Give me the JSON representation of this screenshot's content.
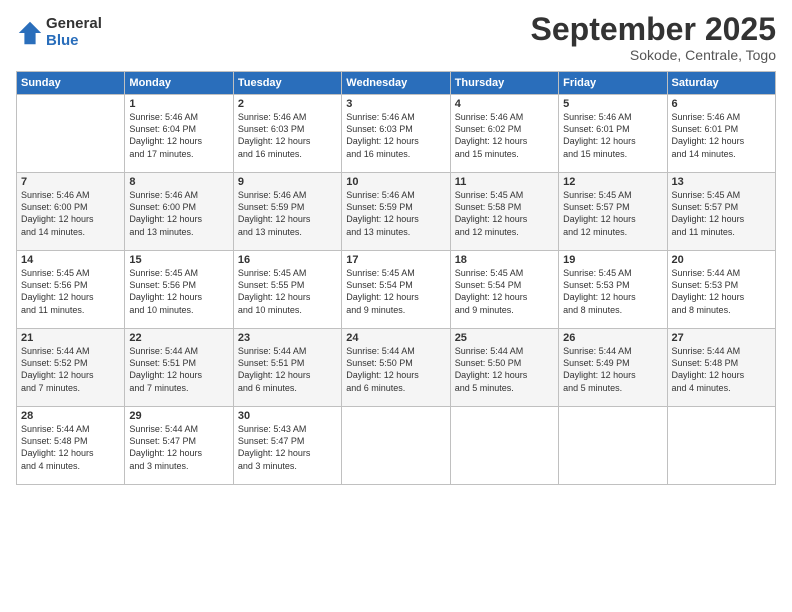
{
  "logo": {
    "general": "General",
    "blue": "Blue"
  },
  "header": {
    "month": "September 2025",
    "location": "Sokode, Centrale, Togo"
  },
  "days_of_week": [
    "Sunday",
    "Monday",
    "Tuesday",
    "Wednesday",
    "Thursday",
    "Friday",
    "Saturday"
  ],
  "weeks": [
    [
      {
        "day": "",
        "data": ""
      },
      {
        "day": "1",
        "data": "Sunrise: 5:46 AM\nSunset: 6:04 PM\nDaylight: 12 hours\nand 17 minutes."
      },
      {
        "day": "2",
        "data": "Sunrise: 5:46 AM\nSunset: 6:03 PM\nDaylight: 12 hours\nand 16 minutes."
      },
      {
        "day": "3",
        "data": "Sunrise: 5:46 AM\nSunset: 6:03 PM\nDaylight: 12 hours\nand 16 minutes."
      },
      {
        "day": "4",
        "data": "Sunrise: 5:46 AM\nSunset: 6:02 PM\nDaylight: 12 hours\nand 15 minutes."
      },
      {
        "day": "5",
        "data": "Sunrise: 5:46 AM\nSunset: 6:01 PM\nDaylight: 12 hours\nand 15 minutes."
      },
      {
        "day": "6",
        "data": "Sunrise: 5:46 AM\nSunset: 6:01 PM\nDaylight: 12 hours\nand 14 minutes."
      }
    ],
    [
      {
        "day": "7",
        "data": "Sunrise: 5:46 AM\nSunset: 6:00 PM\nDaylight: 12 hours\nand 14 minutes."
      },
      {
        "day": "8",
        "data": "Sunrise: 5:46 AM\nSunset: 6:00 PM\nDaylight: 12 hours\nand 13 minutes."
      },
      {
        "day": "9",
        "data": "Sunrise: 5:46 AM\nSunset: 5:59 PM\nDaylight: 12 hours\nand 13 minutes."
      },
      {
        "day": "10",
        "data": "Sunrise: 5:46 AM\nSunset: 5:59 PM\nDaylight: 12 hours\nand 13 minutes."
      },
      {
        "day": "11",
        "data": "Sunrise: 5:45 AM\nSunset: 5:58 PM\nDaylight: 12 hours\nand 12 minutes."
      },
      {
        "day": "12",
        "data": "Sunrise: 5:45 AM\nSunset: 5:57 PM\nDaylight: 12 hours\nand 12 minutes."
      },
      {
        "day": "13",
        "data": "Sunrise: 5:45 AM\nSunset: 5:57 PM\nDaylight: 12 hours\nand 11 minutes."
      }
    ],
    [
      {
        "day": "14",
        "data": "Sunrise: 5:45 AM\nSunset: 5:56 PM\nDaylight: 12 hours\nand 11 minutes."
      },
      {
        "day": "15",
        "data": "Sunrise: 5:45 AM\nSunset: 5:56 PM\nDaylight: 12 hours\nand 10 minutes."
      },
      {
        "day": "16",
        "data": "Sunrise: 5:45 AM\nSunset: 5:55 PM\nDaylight: 12 hours\nand 10 minutes."
      },
      {
        "day": "17",
        "data": "Sunrise: 5:45 AM\nSunset: 5:54 PM\nDaylight: 12 hours\nand 9 minutes."
      },
      {
        "day": "18",
        "data": "Sunrise: 5:45 AM\nSunset: 5:54 PM\nDaylight: 12 hours\nand 9 minutes."
      },
      {
        "day": "19",
        "data": "Sunrise: 5:45 AM\nSunset: 5:53 PM\nDaylight: 12 hours\nand 8 minutes."
      },
      {
        "day": "20",
        "data": "Sunrise: 5:44 AM\nSunset: 5:53 PM\nDaylight: 12 hours\nand 8 minutes."
      }
    ],
    [
      {
        "day": "21",
        "data": "Sunrise: 5:44 AM\nSunset: 5:52 PM\nDaylight: 12 hours\nand 7 minutes."
      },
      {
        "day": "22",
        "data": "Sunrise: 5:44 AM\nSunset: 5:51 PM\nDaylight: 12 hours\nand 7 minutes."
      },
      {
        "day": "23",
        "data": "Sunrise: 5:44 AM\nSunset: 5:51 PM\nDaylight: 12 hours\nand 6 minutes."
      },
      {
        "day": "24",
        "data": "Sunrise: 5:44 AM\nSunset: 5:50 PM\nDaylight: 12 hours\nand 6 minutes."
      },
      {
        "day": "25",
        "data": "Sunrise: 5:44 AM\nSunset: 5:50 PM\nDaylight: 12 hours\nand 5 minutes."
      },
      {
        "day": "26",
        "data": "Sunrise: 5:44 AM\nSunset: 5:49 PM\nDaylight: 12 hours\nand 5 minutes."
      },
      {
        "day": "27",
        "data": "Sunrise: 5:44 AM\nSunset: 5:48 PM\nDaylight: 12 hours\nand 4 minutes."
      }
    ],
    [
      {
        "day": "28",
        "data": "Sunrise: 5:44 AM\nSunset: 5:48 PM\nDaylight: 12 hours\nand 4 minutes."
      },
      {
        "day": "29",
        "data": "Sunrise: 5:44 AM\nSunset: 5:47 PM\nDaylight: 12 hours\nand 3 minutes."
      },
      {
        "day": "30",
        "data": "Sunrise: 5:43 AM\nSunset: 5:47 PM\nDaylight: 12 hours\nand 3 minutes."
      },
      {
        "day": "",
        "data": ""
      },
      {
        "day": "",
        "data": ""
      },
      {
        "day": "",
        "data": ""
      },
      {
        "day": "",
        "data": ""
      }
    ]
  ]
}
